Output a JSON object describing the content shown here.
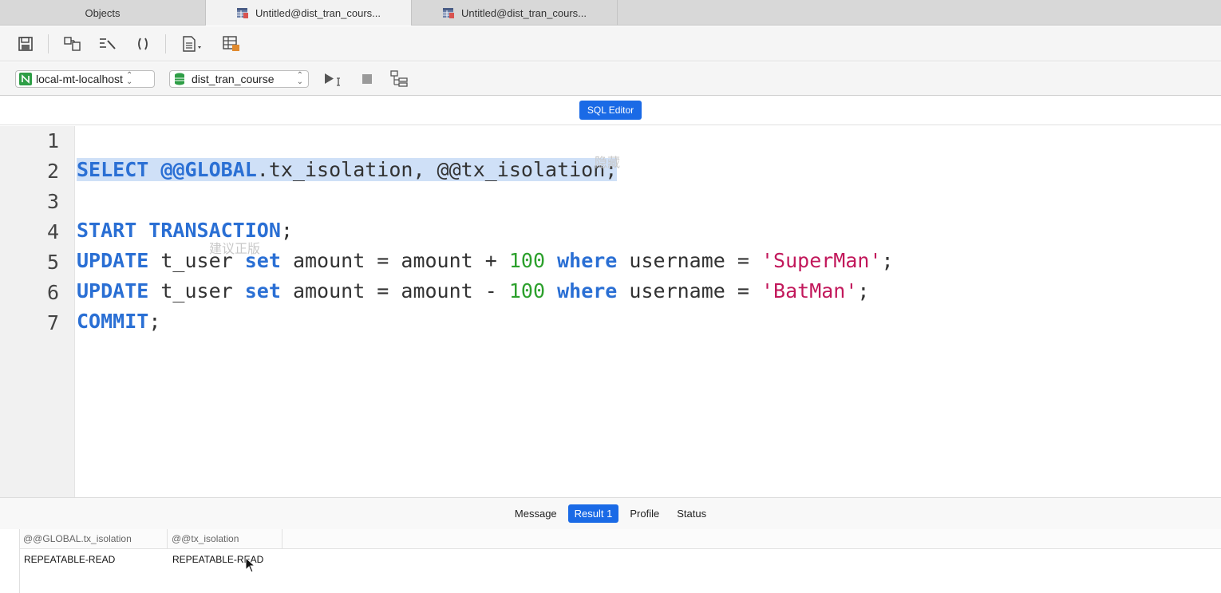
{
  "tabs": [
    {
      "label": "Objects",
      "active": false
    },
    {
      "label": "Untitled@dist_tran_cours...",
      "active": true
    },
    {
      "label": "Untitled@dist_tran_cours...",
      "active": false
    }
  ],
  "toolbar": {
    "icons": [
      "save-icon",
      "query-builder-icon",
      "beautify-sql-icon",
      "code-snippet-icon",
      "text-file-icon",
      "export-result-icon"
    ]
  },
  "connection": {
    "server": "local-mt-localhost",
    "database": "dist_tran_course"
  },
  "editor": {
    "mode_label": "SQL Editor",
    "line_numbers": [
      "1",
      "2",
      "3",
      "4",
      "5",
      "6",
      "7"
    ]
  },
  "code": {
    "l2": {
      "kw1": "SELECT",
      "t1": " @@GLOBAL",
      "t2": ".tx_isolation, @@tx_isolation;"
    },
    "l4": {
      "kw1": "START TRANSACTION",
      "t1": ";"
    },
    "l5": {
      "kw1": "UPDATE",
      "t1": " t_user ",
      "kw2": "set",
      "t2": " amount = amount + ",
      "num": "100",
      "t3": " ",
      "kw3": "where",
      "t4": " username = ",
      "str": "'SuperMan'",
      "t5": ";"
    },
    "l6": {
      "kw1": "UPDATE",
      "t1": " t_user ",
      "kw2": "set",
      "t2": " amount = amount - ",
      "num": "100",
      "t3": " ",
      "kw3": "where",
      "t4": " username = ",
      "str": "'BatMan'",
      "t5": ";"
    },
    "l7": {
      "kw1": "COMMIT",
      "t1": ";"
    }
  },
  "watermarks": [
    "隐藏",
    "建议正版"
  ],
  "results": {
    "tabs": [
      {
        "label": "Message",
        "active": false
      },
      {
        "label": "Result 1",
        "active": true
      },
      {
        "label": "Profile",
        "active": false
      },
      {
        "label": "Status",
        "active": false
      }
    ],
    "columns": [
      "@@GLOBAL.tx_isolation",
      "@@tx_isolation"
    ],
    "rows": [
      [
        "REPEATABLE-READ",
        "REPEATABLE-READ"
      ]
    ]
  },
  "colors": {
    "accent": "#1a6ae6",
    "keyword": "#2a6fd4",
    "number": "#2ca02c",
    "string": "#c2185b",
    "selection": "#cfe0f7"
  }
}
